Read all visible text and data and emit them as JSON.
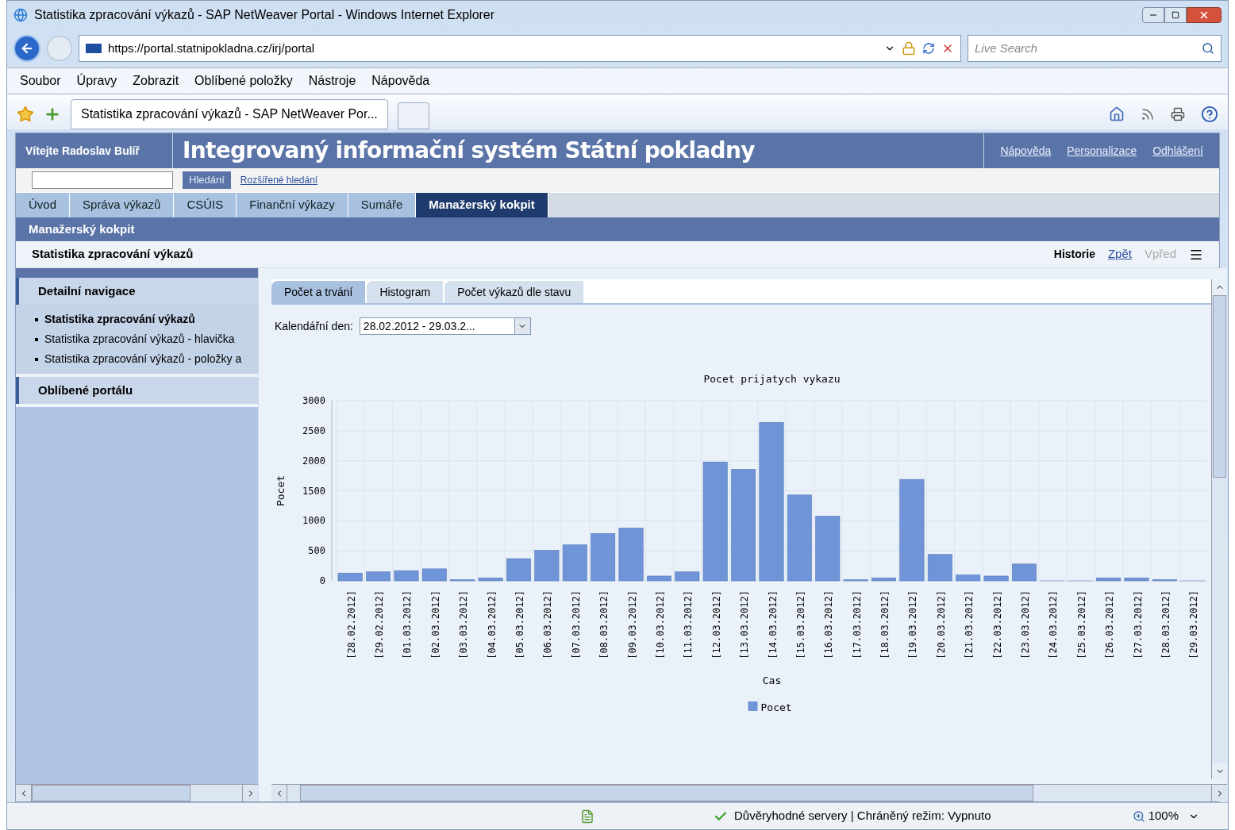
{
  "window": {
    "title": "Statistika zpracování výkazů - SAP NetWeaver Portal - Windows Internet Explorer"
  },
  "address_bar": {
    "url": "https://portal.statnipokladna.cz/irj/portal"
  },
  "search": {
    "placeholder": "Live Search"
  },
  "menu": [
    "Soubor",
    "Úpravy",
    "Zobrazit",
    "Oblíbené položky",
    "Nástroje",
    "Nápověda"
  ],
  "browser_tabs": [
    {
      "label": "Statistika zpracování výkazů - SAP NetWeaver Por...",
      "selected": true
    }
  ],
  "portal": {
    "welcome": "Vítejte Radoslav Bulíř",
    "title": "Integrovaný informační systém Státní pokladny",
    "header_links": [
      "Nápověda",
      "Personalizace",
      "Odhlášení"
    ],
    "search_button": "Hledání",
    "advanced_search": "Rozšířené hledání",
    "tabs": [
      {
        "label": "Úvod",
        "selected": false
      },
      {
        "label": "Správa výkazů",
        "selected": false
      },
      {
        "label": "CSÚIS",
        "selected": false
      },
      {
        "label": "Finanční výkazy",
        "selected": false
      },
      {
        "label": "Sumáře",
        "selected": false
      },
      {
        "label": "Manažerský kokpit",
        "selected": true
      }
    ],
    "subnav": [
      {
        "label": "Manažerský kokpit",
        "selected": true
      }
    ],
    "page_title": "Statistika zpracování výkazů",
    "history": "Historie",
    "back": {
      "label": "Zpět",
      "disabled": false
    },
    "forward": {
      "label": "Vpřed",
      "disabled": true
    }
  },
  "nav": [
    {
      "title": "Detailní navigace",
      "items": [
        {
          "label": "Statistika zpracování výkazů",
          "selected": true
        },
        {
          "label": "Statistika zpracování výkazů - hlavička",
          "selected": false
        },
        {
          "label": "Statistika zpracování výkazů - položky a",
          "selected": false
        }
      ]
    },
    {
      "title": "Oblíbené portálu"
    }
  ],
  "content_tabs": [
    {
      "label": "Počet a trvání",
      "selected": true
    },
    {
      "label": "Histogram",
      "selected": false
    },
    {
      "label": "Počet výkazů dle stavu",
      "selected": false
    }
  ],
  "filter": {
    "label": "Kalendářní den:",
    "value": "28.02.2012 - 29.03.2..."
  },
  "chart_data": {
    "type": "bar",
    "title": "Pocet prijatych vykazu",
    "xlabel": "Cas",
    "ylabel": "Pocet",
    "grid": true,
    "categories": [
      "[28.02.2012]",
      "[29.02.2012]",
      "[01.03.2012]",
      "[02.03.2012]",
      "[03.03.2012]",
      "[04.03.2012]",
      "[05.03.2012]",
      "[06.03.2012]",
      "[07.03.2012]",
      "[08.03.2012]",
      "[09.03.2012]",
      "[10.03.2012]",
      "[11.03.2012]",
      "[12.03.2012]",
      "[13.03.2012]",
      "[14.03.2012]",
      "[15.03.2012]",
      "[16.03.2012]",
      "[17.03.2012]",
      "[18.03.2012]",
      "[19.03.2012]",
      "[20.03.2012]",
      "[21.03.2012]",
      "[22.03.2012]",
      "[23.03.2012]",
      "[24.03.2012]",
      "[25.03.2012]",
      "[26.03.2012]",
      "[27.03.2012]",
      "[28.03.2012]",
      "[29.03.2012]"
    ],
    "series": [
      {
        "name": "Pocet",
        "color": "#6f95d8",
        "values": [
          130,
          150,
          170,
          200,
          20,
          50,
          370,
          510,
          600,
          790,
          880,
          80,
          150,
          1980,
          1860,
          2640,
          1430,
          1080,
          20,
          50,
          1690,
          440,
          100,
          80,
          280,
          0,
          0,
          50,
          50,
          20,
          0
        ]
      }
    ],
    "ylim": [
      0,
      3000
    ],
    "yticks": [
      0,
      500,
      1000,
      1500,
      2000,
      2500,
      3000
    ]
  },
  "status_bar": {
    "text": "Důvěryhodné servery | Chráněný režim: Vypnuto",
    "zoom": "100%"
  }
}
